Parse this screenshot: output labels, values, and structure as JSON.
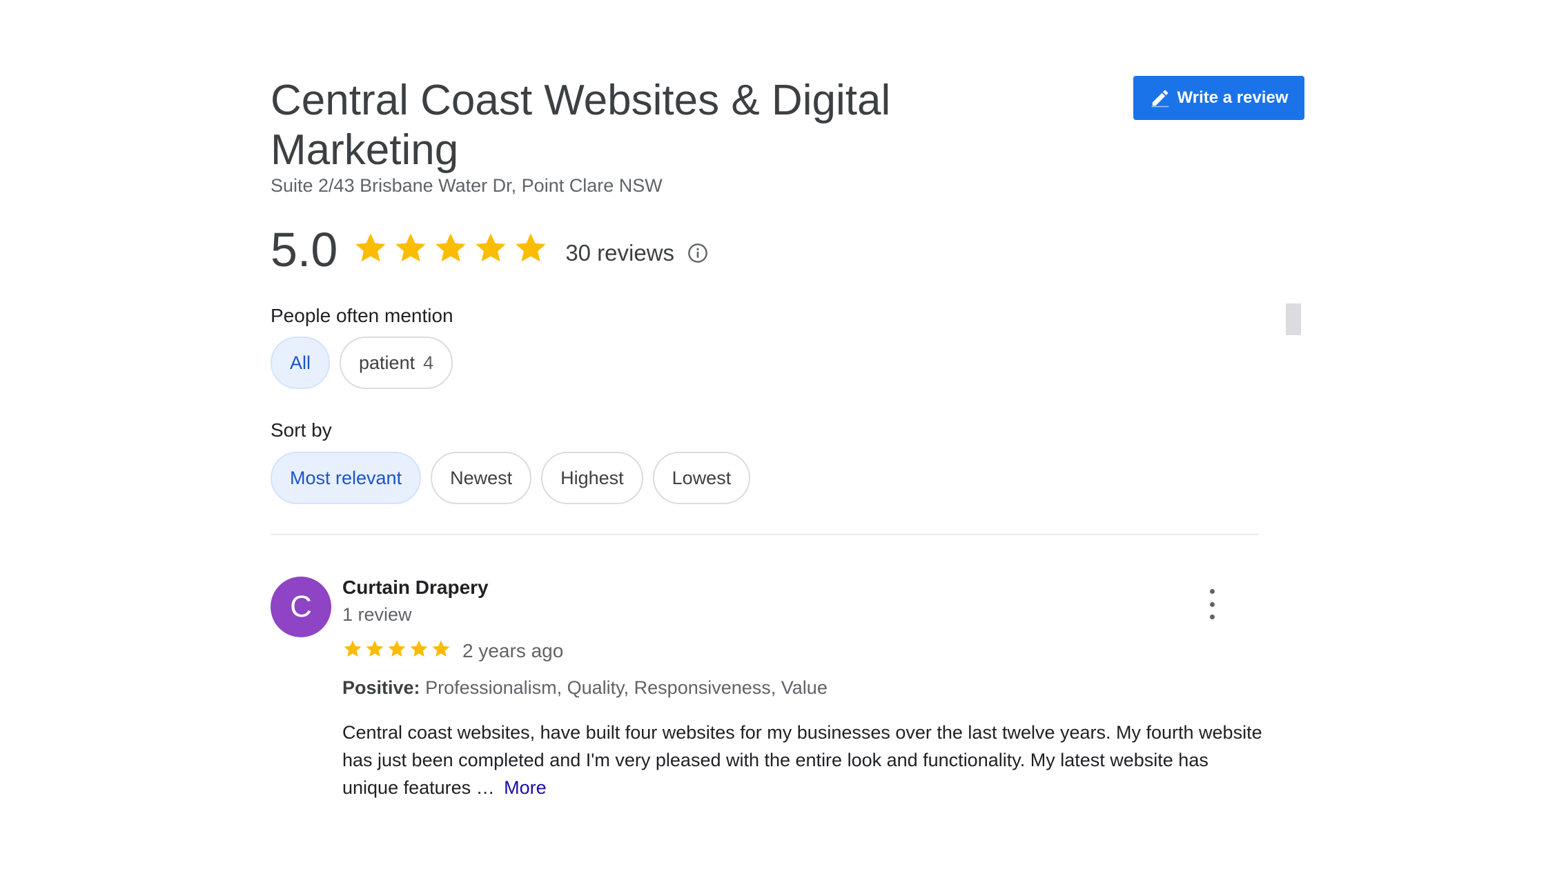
{
  "business": {
    "name": "Central Coast Websites & Digital Marketing",
    "address": "Suite 2/43 Brisbane Water Dr, Point Clare NSW"
  },
  "write_review": {
    "label": "Write a review",
    "icon": "pencil-icon"
  },
  "rating": {
    "score": "5.0",
    "stars": 5,
    "review_count_label": "30 reviews",
    "info_icon": "info-icon"
  },
  "mentions": {
    "label": "People often mention",
    "chips": [
      {
        "label": "All",
        "count": "",
        "active": true
      },
      {
        "label": "patient",
        "count": "4",
        "active": false
      }
    ]
  },
  "sort": {
    "label": "Sort by",
    "options": [
      {
        "label": "Most relevant",
        "active": true
      },
      {
        "label": "Newest",
        "active": false
      },
      {
        "label": "Highest",
        "active": false
      },
      {
        "label": "Lowest",
        "active": false
      }
    ]
  },
  "reviews": [
    {
      "avatar_letter": "C",
      "name": "Curtain Drapery",
      "meta": "1 review",
      "stars": 5,
      "date": "2 years ago",
      "positive_label": "Positive:",
      "positive_values": "Professionalism, Quality, Responsiveness, Value",
      "text": "Central coast websites, have built four websites for my businesses over the last twelve years.  My fourth website has just been completed and I'm very pleased with the entire look and functionality.  My latest website has unique features …",
      "more_label": "More"
    }
  ],
  "colors": {
    "accent": "#1a73e8",
    "star": "#fbbc04",
    "avatar": "#8e44c4",
    "chip_active_bg": "#e8f0fe",
    "link": "#1a0dab"
  }
}
